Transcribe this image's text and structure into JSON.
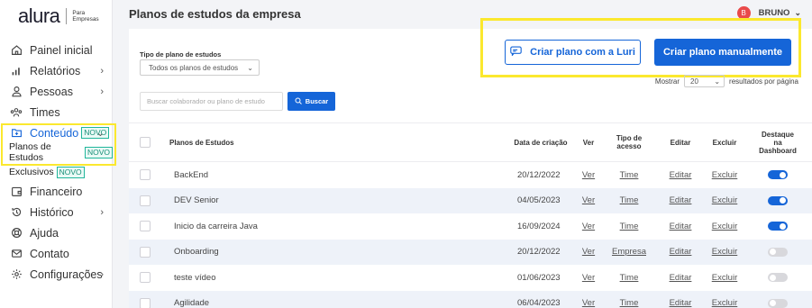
{
  "brand": {
    "name": "alura",
    "sub_line1": "Para",
    "sub_line2": "Empresas"
  },
  "sidebar": {
    "items": [
      {
        "label": "Painel inicial",
        "icon": "home-icon",
        "chevron": ""
      },
      {
        "label": "Relatórios",
        "icon": "bar-chart-icon",
        "chevron": "›"
      },
      {
        "label": "Pessoas",
        "icon": "person-icon",
        "chevron": "›"
      },
      {
        "label": "Times",
        "icon": "team-icon",
        "chevron": ""
      },
      {
        "label": "Conteúdo",
        "icon": "content-folder-icon",
        "badge": "NOVO",
        "chevron": "⌄"
      },
      {
        "label": "Planos de Estudos",
        "badge": "NOVO"
      },
      {
        "label": "Exclusivos",
        "badge": "NOVO"
      },
      {
        "label": "Financeiro",
        "icon": "wallet-icon",
        "chevron": ""
      },
      {
        "label": "Histórico",
        "icon": "history-icon",
        "chevron": "›"
      },
      {
        "label": "Ajuda",
        "icon": "help-icon",
        "chevron": ""
      },
      {
        "label": "Contato",
        "icon": "mail-icon",
        "chevron": ""
      },
      {
        "label": "Configurações",
        "icon": "gear-icon",
        "chevron": "›"
      }
    ]
  },
  "header": {
    "title": "Planos de estudos da empresa",
    "user_initial": "B",
    "user_name": "BRUNO"
  },
  "filters": {
    "type_label": "Tipo de plano de estudos",
    "type_value": "Todos os planos de estudos",
    "search_placeholder": "Buscar colaborador ou plano de estudo",
    "search_button": "Buscar"
  },
  "actions": {
    "luri_button": "Criar plano com a Luri",
    "manual_button": "Criar plano manualmente"
  },
  "pagination": {
    "show_label": "Mostrar",
    "per_page": "20",
    "suffix": "resultados por página"
  },
  "table": {
    "headers": {
      "name": "Planos de Estudos",
      "date": "Data de criação",
      "view": "Ver",
      "access_l1": "Tipo de",
      "access_l2": "acesso",
      "edit": "Editar",
      "delete": "Excluir",
      "dash_l1": "Destaque",
      "dash_l2": "na",
      "dash_l3": "Dashboard"
    },
    "rows": [
      {
        "name": "BackEnd",
        "date": "20/12/2022",
        "view": "Ver",
        "access": "Time",
        "edit": "Editar",
        "delete": "Excluir",
        "featured": true
      },
      {
        "name": "DEV Senior",
        "date": "04/05/2023",
        "view": "Ver",
        "access": "Time",
        "edit": "Editar",
        "delete": "Excluir",
        "featured": true
      },
      {
        "name": "Inicio da carreira Java",
        "date": "16/09/2024",
        "view": "Ver",
        "access": "Time",
        "edit": "Editar",
        "delete": "Excluir",
        "featured": true
      },
      {
        "name": "Onboarding",
        "date": "20/12/2022",
        "view": "Ver",
        "access": "Empresa",
        "edit": "Editar",
        "delete": "Excluir",
        "featured": false
      },
      {
        "name": "teste vídeo",
        "date": "01/06/2023",
        "view": "Ver",
        "access": "Time",
        "edit": "Editar",
        "delete": "Excluir",
        "featured": false
      },
      {
        "name": "Agilidade",
        "date": "06/04/2023",
        "view": "Ver",
        "access": "Time",
        "edit": "Editar",
        "delete": "Excluir",
        "featured": false
      }
    ]
  },
  "colors": {
    "accent": "#1565d8",
    "highlight": "#fbe82e",
    "badge": "#20b69b",
    "avatar": "#e94a4a"
  }
}
